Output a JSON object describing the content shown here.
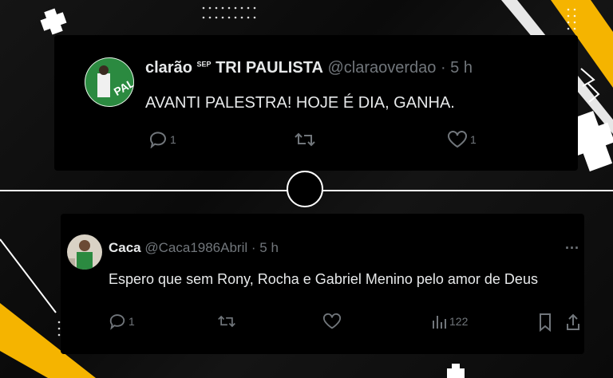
{
  "tweet1": {
    "display_name": "clarão",
    "badge": "SEP",
    "display_name_suffix": "TRI PAULISTA",
    "handle": "@claraoverdao",
    "time": "· 5 h",
    "text": "AVANTI PALESTRA! HOJE É DIA, GANHA.",
    "reply_count": "1",
    "like_count": "1"
  },
  "tweet2": {
    "display_name": "Caca",
    "handle": "@Caca1986Abril",
    "time": "· 5 h",
    "text": "Espero que sem Rony, Rocha e Gabriel Menino pelo amor de Deus",
    "reply_count": "1",
    "view_count": "122",
    "more": "..."
  },
  "colors": {
    "accent_yellow": "#f5b400",
    "text_primary": "#e7e9ea",
    "text_secondary": "#71767b",
    "palmeiras_green": "#1f7a3a"
  }
}
